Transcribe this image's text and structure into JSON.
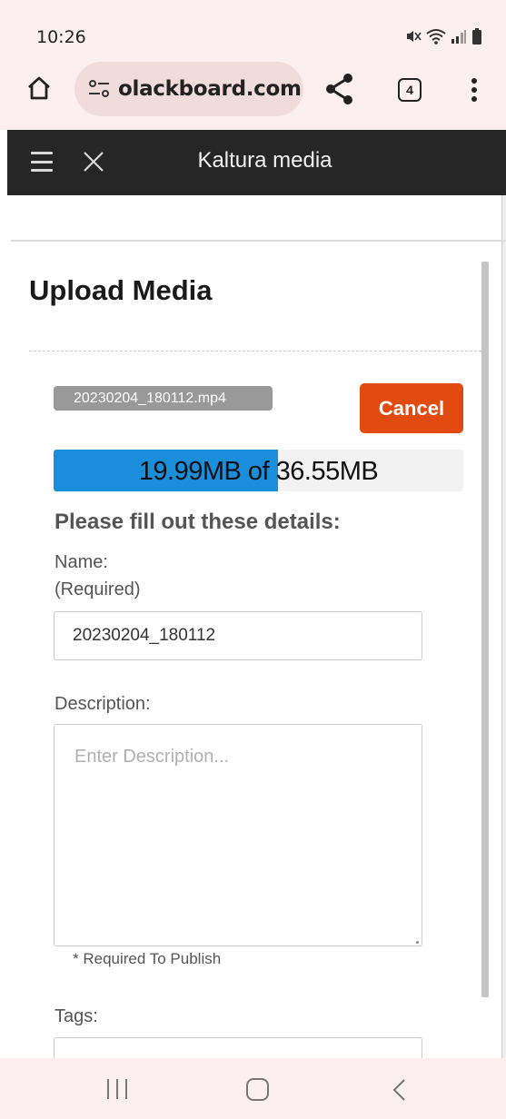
{
  "status_bar": {
    "time": "10:26",
    "icons": [
      "mute-icon",
      "wifi-icon",
      "signal-icon",
      "battery-icon"
    ]
  },
  "browser": {
    "url": "olackboard.com",
    "tab_count": "4",
    "icons": [
      "home-icon",
      "tune-icon",
      "share-icon",
      "more-vert-icon"
    ]
  },
  "app_header": {
    "title": "Kaltura media",
    "icons": [
      "hamburger-menu-icon",
      "close-icon"
    ]
  },
  "upload": {
    "page_title": "Upload Media",
    "file_name": "20230204_180112.mp4",
    "cancel_label": "Cancel",
    "progress_text": "19.99MB of 36.55MB",
    "progress_fraction": 0.547,
    "details_heading": "Please fill out these details:",
    "name_label": "Name:",
    "name_required": "(Required)",
    "name_value": "20230204_180112",
    "description_label": "Description:",
    "description_placeholder": "Enter Description...",
    "required_note": "* Required To Publish",
    "tags_label": "Tags:"
  },
  "colors": {
    "accent": "#e14b10",
    "progress": "#1b8edb",
    "header_bg": "#262626",
    "browser_bg": "#fbf0ef"
  },
  "nav_bar": {
    "icons": [
      "recents-icon",
      "home-circle-icon",
      "back-icon"
    ]
  }
}
